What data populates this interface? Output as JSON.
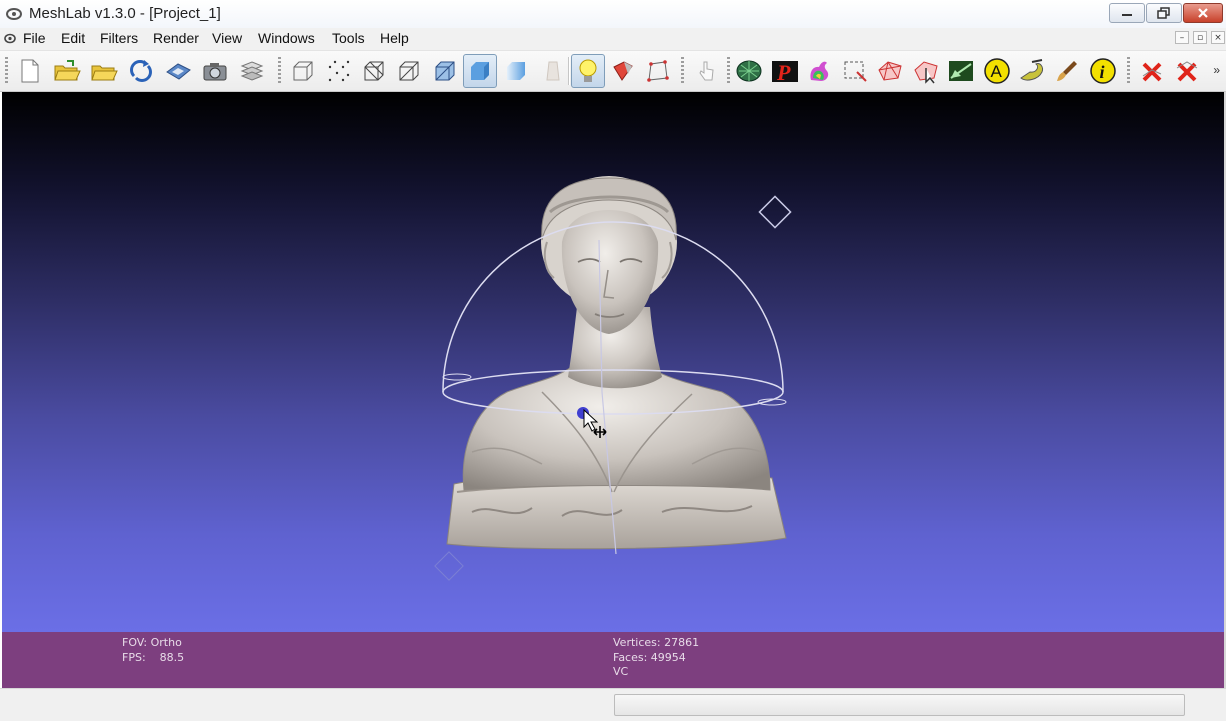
{
  "window": {
    "title": "MeshLab v1.3.0 - [Project_1]",
    "controls": [
      "minimize",
      "maximize",
      "close"
    ]
  },
  "menubar": {
    "items": [
      "File",
      "Edit",
      "Filters",
      "Render",
      "View",
      "Windows",
      "Tools",
      "Help"
    ],
    "mdi_controls": [
      "–",
      "▫",
      "×"
    ]
  },
  "toolbar": {
    "active_tools": [
      "flat-shading-icon",
      "lighting-bulb-icon"
    ],
    "overflow_label": "»"
  },
  "viewport": {
    "background_top": "#000000",
    "background_bottom": "#6b6fe6",
    "model": "marble bust"
  },
  "info": {
    "fov_line": "FOV: Ortho",
    "fps_line": "FPS:    88.5",
    "vertices_line": "Vertices: 27861",
    "faces_line": "Faces: 49954",
    "vc_line": "VC"
  },
  "colors": {
    "info_panel": "#7d3f7f",
    "trackball": "#dcdcf0"
  }
}
